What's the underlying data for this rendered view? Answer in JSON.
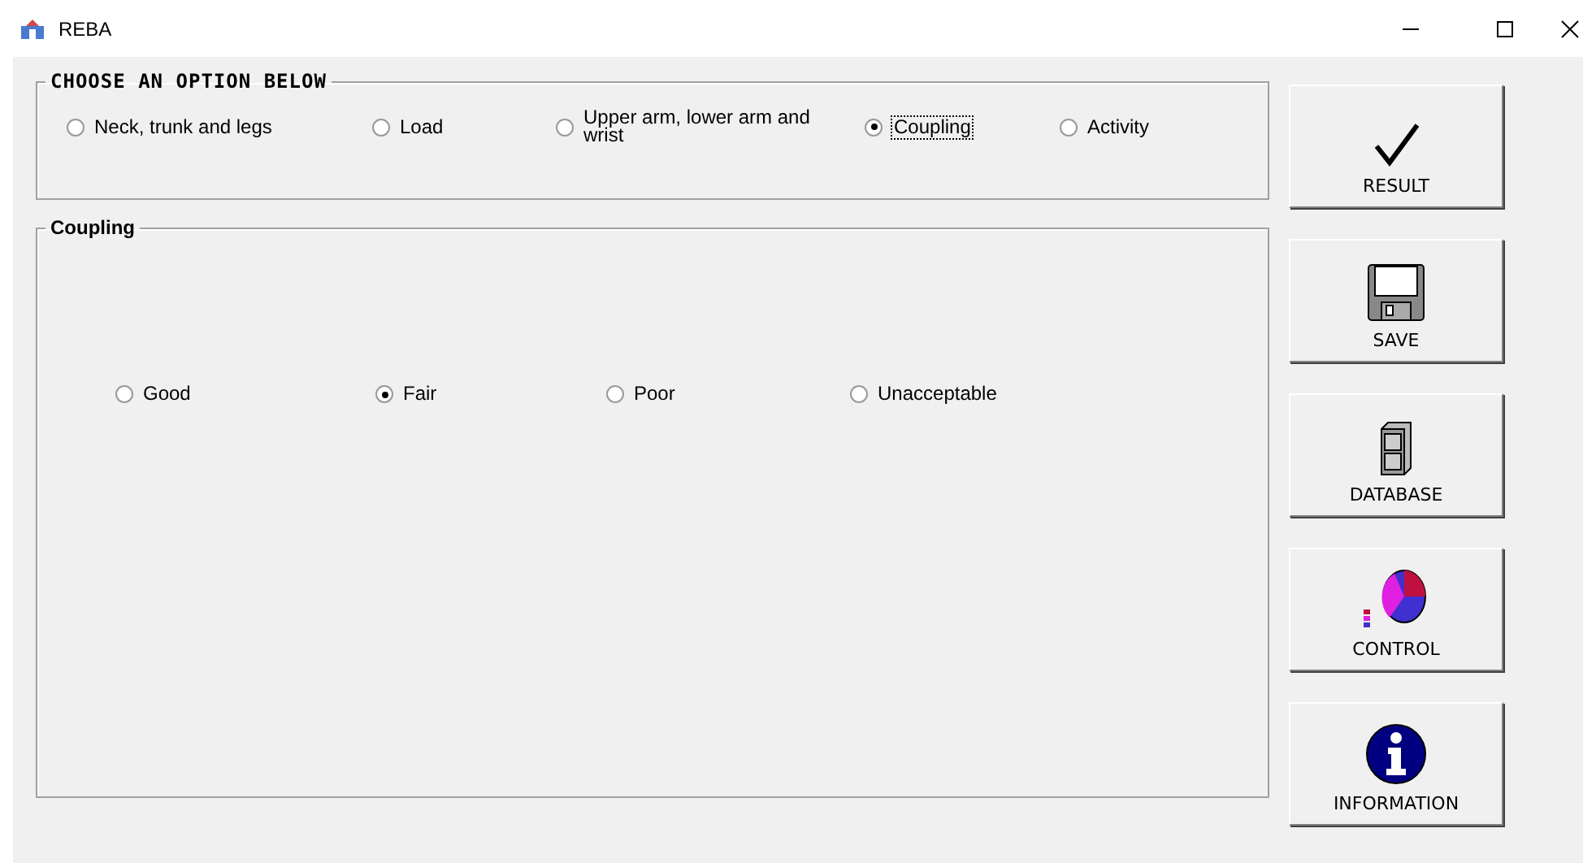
{
  "window": {
    "title": "REBA"
  },
  "options_group": {
    "title": "CHOOSE AN OPTION BELOW",
    "options": [
      {
        "label": "Neck, trunk and legs",
        "selected": false
      },
      {
        "label": "Load",
        "selected": false
      },
      {
        "label": "Upper arm, lower arm and wrist",
        "selected": false
      },
      {
        "label": "Coupling",
        "selected": true
      },
      {
        "label": "Activity",
        "selected": false
      }
    ]
  },
  "coupling_group": {
    "title": "Coupling",
    "options": [
      {
        "label": "Good",
        "selected": false
      },
      {
        "label": "Fair",
        "selected": true
      },
      {
        "label": "Poor",
        "selected": false
      },
      {
        "label": "Unacceptable",
        "selected": false
      }
    ]
  },
  "buttons": [
    {
      "label": "RESULT",
      "kind": "check"
    },
    {
      "label": "SAVE",
      "kind": "disk"
    },
    {
      "label": "DATABASE",
      "kind": "cabinet"
    },
    {
      "label": "CONTROL",
      "kind": "chart"
    },
    {
      "label": "INFORMATION",
      "kind": "info"
    }
  ]
}
